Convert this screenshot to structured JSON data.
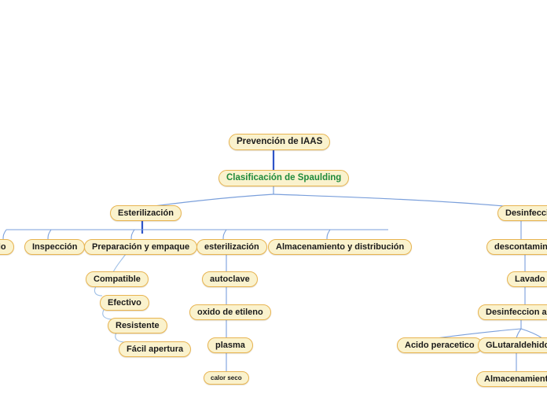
{
  "document": {
    "title": "Prevención de IAAS",
    "type": "mind-map",
    "background_color": "#ffffff"
  },
  "style": {
    "node_fill": "#faf2cd",
    "node_border": "#e8b451",
    "text_color": "#1a1a1a",
    "accent_text_color": "#1f8a3b",
    "edge_color": "#7a9fdb",
    "trunk_color": "#2e54c8"
  },
  "nodes": {
    "root": "Prevención de IAAS",
    "spaulding": "Clasificación de Spaulding",
    "esterilizacion": "Esterilización",
    "desinfeccion": "Desinfección",
    "lavado_left": "ado",
    "inspeccion": "Inspección",
    "preparacion": "Preparación y empaque",
    "esterilizacion_step": "esterilización",
    "almacenamiento_dist": "Almacenamiento y distribución",
    "compatible": "Compatible",
    "efectivo": "Efectivo",
    "resistente": "Resistente",
    "facil_apertura": "Fácil apertura",
    "autoclave": "autoclave",
    "oxido_etileno": "oxido de etileno",
    "plasma": "plasma",
    "calor_seco": "calor seco",
    "descontaminacion": "descontaminac",
    "lavado_right": "Lavado",
    "desinfeccion_alto": "Desinfeccion alto",
    "acido_peracetico": "Acido peracetico",
    "glutaraldehido": "GLutaraldehido",
    "almacenamiento": "Almacenamiento"
  }
}
